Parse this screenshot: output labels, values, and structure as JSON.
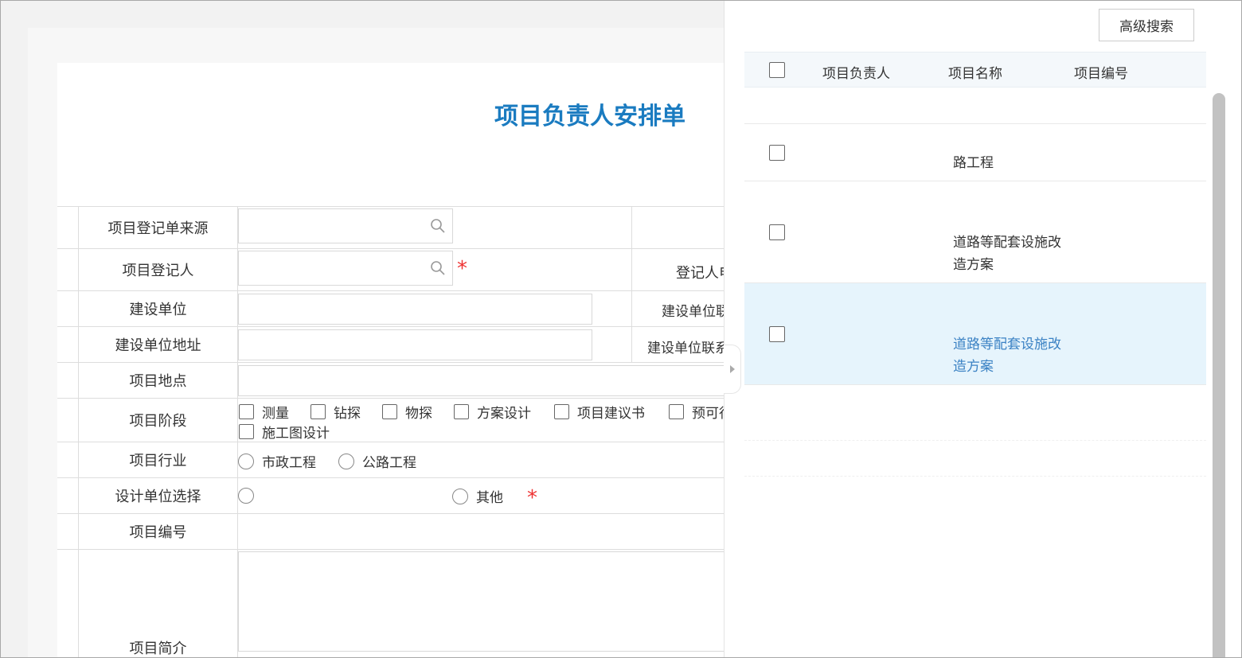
{
  "form": {
    "title": "项目负责人安排单",
    "rows": {
      "source_label": "项目登记单来源",
      "registrant_label": "项目登记人",
      "registrant_phone_label": "登记人电",
      "construction_unit_label": "建设单位",
      "construction_unit_contact_label": "建设单位联",
      "construction_unit_address_label": "建设单位地址",
      "construction_unit_phone_label": "建设单位联系",
      "location_label": "项目地点",
      "stage_label": "项目阶段",
      "industry_label": "项目行业",
      "design_unit_label": "设计单位选择",
      "project_no_label": "项目编号",
      "intro_label": "项目简介"
    },
    "required_mark": "*",
    "stage_options": [
      "测量",
      "钻探",
      "物探",
      "方案设计",
      "项目建议书",
      "预可行",
      "施工图设计"
    ],
    "industry_options": [
      "市政工程",
      "公路工程"
    ],
    "design_unit_options": [
      "",
      "其他"
    ]
  },
  "panel": {
    "advanced_search_label": "高级搜索",
    "columns": [
      "项目负责人",
      "项目名称",
      "项目编号"
    ],
    "rows": [
      {
        "name_lines": [
          "路工程"
        ],
        "selected": false
      },
      {
        "name_lines": [
          "道路等配套设施改",
          "造方案"
        ],
        "selected": false
      },
      {
        "name_lines": [
          "道路等配套设施改",
          "造方案"
        ],
        "selected": true
      }
    ],
    "selected_row_color": "#e6f4fc",
    "link_color": "#3b82c4"
  },
  "colors": {
    "title": "#1a7bc0",
    "required": "#e33333"
  }
}
